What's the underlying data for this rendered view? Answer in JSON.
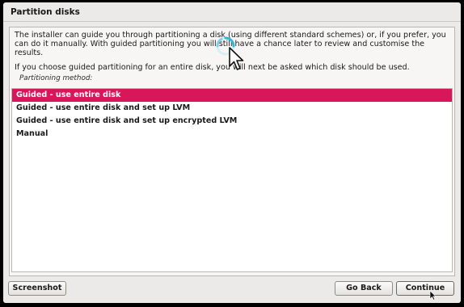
{
  "window": {
    "title": "Partition disks"
  },
  "description": {
    "paragraph1": "The installer can guide you through partitioning a disk (using different standard schemes) or, if you prefer, you can do it manually. With guided partitioning you will still have a chance later to review and customise the results.",
    "paragraph2": "If you choose guided partitioning for an entire disk, you will next be asked which disk should be used."
  },
  "partitioning": {
    "label": "Partitioning method:",
    "options": [
      "Guided - use entire disk",
      "Guided - use entire disk and set up LVM",
      "Guided - use entire disk and set up encrypted LVM",
      "Manual"
    ],
    "selected_index": 0
  },
  "buttons": {
    "screenshot": "Screenshot",
    "go_back": "Go Back",
    "continue": "Continue"
  },
  "colors": {
    "selection": "#d8165a",
    "window_background": "#ebeae8",
    "spinner_accent": "#34b7d6"
  },
  "icons": {
    "loading": "loading-spinner-icon",
    "pointer": "mouse-pointer-icon"
  }
}
